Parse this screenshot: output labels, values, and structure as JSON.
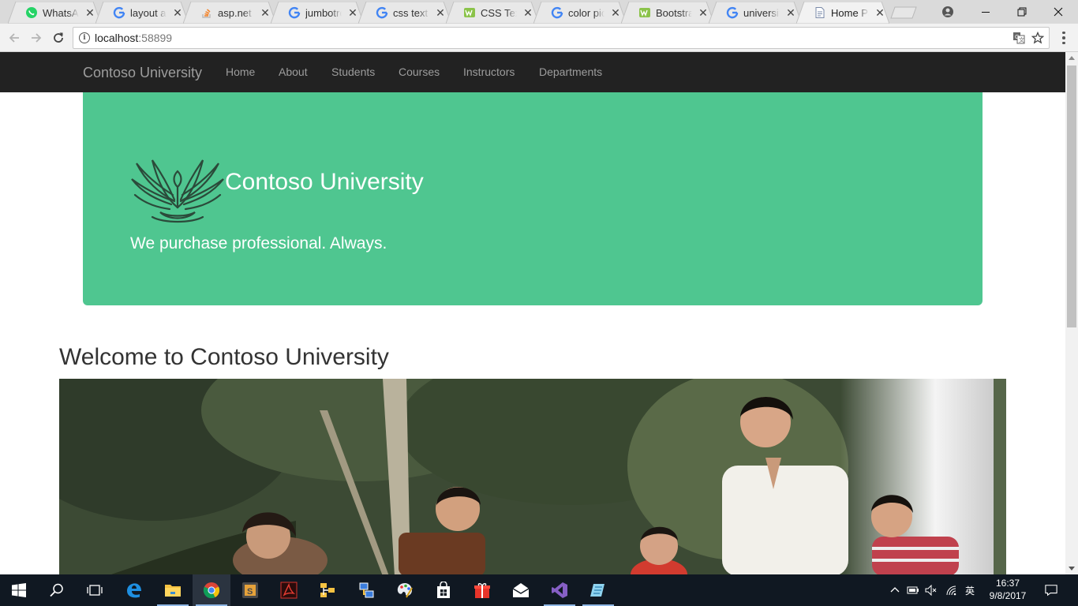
{
  "browser": {
    "tabs": [
      {
        "title": "WhatsApp",
        "icon": "whatsapp-icon"
      },
      {
        "title": "layout asp",
        "icon": "google-icon"
      },
      {
        "title": "asp.net mvc",
        "icon": "stackoverflow-icon"
      },
      {
        "title": "jumbotron",
        "icon": "google-icon"
      },
      {
        "title": "css text color",
        "icon": "google-icon"
      },
      {
        "title": "CSS Text",
        "icon": "w3schools-icon"
      },
      {
        "title": "color picker",
        "icon": "google-icon"
      },
      {
        "title": "Bootstrap",
        "icon": "w3schools-icon"
      },
      {
        "title": "university",
        "icon": "google-icon"
      },
      {
        "title": "Home Page",
        "icon": "page-icon",
        "active": true
      }
    ],
    "close_glyph": "✕",
    "url_host": "localhost",
    "url_port": ":58899"
  },
  "site": {
    "brand": "Contoso University",
    "nav": [
      "Home",
      "About",
      "Students",
      "Courses",
      "Instructors",
      "Departments"
    ]
  },
  "jumbotron": {
    "title": "Contoso University",
    "tagline": "We purchase professional. Always.",
    "background": "#4fc690"
  },
  "welcome": "Welcome to Contoso University",
  "taskbar": {
    "time": "16:37",
    "date": "9/8/2017",
    "ime": "英",
    "apps": [
      "start-icon",
      "search-icon",
      "task-view-icon",
      "edge-icon",
      "file-explorer-icon",
      "chrome-icon",
      "sublime-icon",
      "acrobat-icon",
      "folder-tree-icon",
      "network-icon",
      "paint-icon",
      "store-icon",
      "gift-icon",
      "mail-icon",
      "visual-studio-icon",
      "notepad-icon"
    ]
  },
  "colors": {
    "navbar": "#222222",
    "nav_text": "#9d9d9d",
    "accent": "#4fc690",
    "taskbar": "#101822"
  }
}
